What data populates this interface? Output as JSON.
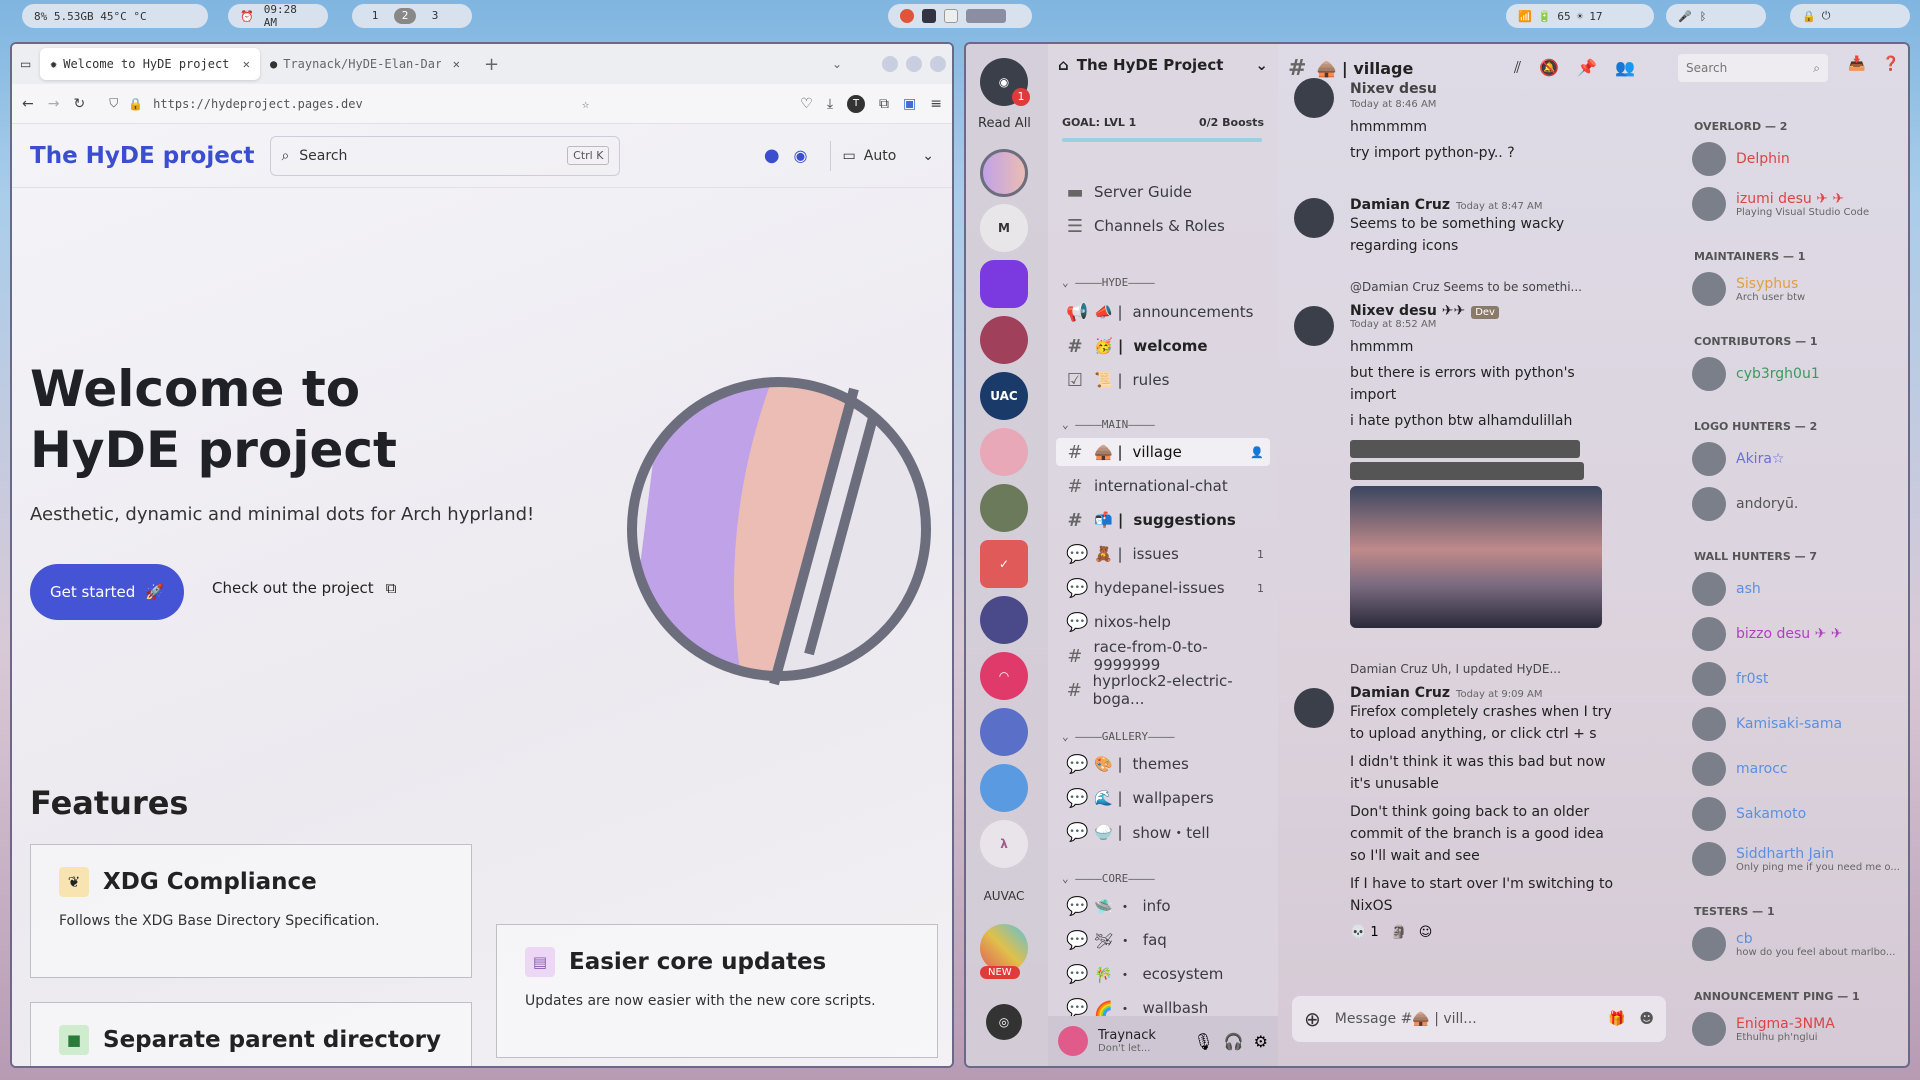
{
  "topbar": {
    "stats": "8%  5.53GB  45°C  °C",
    "time": "09:28 AM",
    "workspaces": [
      "1",
      "2",
      "3"
    ],
    "battery": "65",
    "brightness": "17"
  },
  "browser": {
    "tabs": [
      {
        "label": "Welcome to HyDE project |"
      },
      {
        "label": "Traynack/HyDE-Elan-Dark"
      }
    ],
    "url": "https://hydeproject.pages.dev",
    "site": {
      "brand": "The HyDE project",
      "search_placeholder": "Search",
      "search_kbd": "Ctrl K",
      "theme_label": "Auto",
      "hero_title": "Welcome to HyDE project",
      "hero_subtitle": "Aesthetic, dynamic and minimal dots for Arch hyprland!",
      "cta_primary": "Get started",
      "cta_secondary": "Check out the project",
      "features_heading": "Features",
      "features": [
        {
          "title": "XDG Compliance",
          "desc": "Follows the XDG Base Directory Specification.",
          "color": "#f0c040"
        },
        {
          "title": "Easier core updates",
          "desc": "Updates are now easier with the new core scripts.",
          "color": "#b08ad0"
        },
        {
          "title": "Separate parent directory",
          "desc": "",
          "color": "#3aa05a"
        }
      ]
    }
  },
  "discord": {
    "read_all": "Read All",
    "notif_count": "1",
    "guild_letter": "M",
    "auvac": "AUVAC",
    "new_badge": "NEW",
    "server_name": "The HyDE Project",
    "goal": "GOAL: LVL 1",
    "boosts": "0/2 Boosts",
    "nav": [
      "Server Guide",
      "Channels & Roles"
    ],
    "categories": [
      "HYDE",
      "MAIN",
      "GALLERY",
      "CORE"
    ],
    "channels": [
      {
        "name": "announcements",
        "prefix": "📣 |"
      },
      {
        "name": "welcome",
        "prefix": "🥳 |"
      },
      {
        "name": "rules",
        "prefix": "📜 |"
      },
      {
        "name": "village",
        "prefix": "🛖 |"
      },
      {
        "name": "international-chat",
        "prefix": ""
      },
      {
        "name": "suggestions",
        "prefix": "📬 |"
      },
      {
        "name": "issues",
        "prefix": "🧸 |",
        "badge": "1"
      },
      {
        "name": "hydepanel-issues",
        "prefix": "",
        "badge": "1"
      },
      {
        "name": "nixos-help",
        "prefix": ""
      },
      {
        "name": "race-from-0-to-9999999",
        "prefix": ""
      },
      {
        "name": "hyprlock2-electric-boga...",
        "prefix": ""
      },
      {
        "name": "themes",
        "prefix": "🎨 |"
      },
      {
        "name": "wallpapers",
        "prefix": "🌊 |"
      },
      {
        "name": "show・tell",
        "prefix": "🍚 |"
      },
      {
        "name": "info",
        "prefix": "🛸 ・"
      },
      {
        "name": "faq",
        "prefix": "🛩 ・"
      },
      {
        "name": "ecosystem",
        "prefix": "🎋 ・"
      },
      {
        "name": "wallbash",
        "prefix": "🌈 ・"
      }
    ],
    "user": {
      "name": "Traynack",
      "status": "Don't let..."
    },
    "chat_title": "🛖 | village",
    "search_placeholder": "Search",
    "messages": [
      {
        "name": "Nixev desu",
        "time": "Today at 8:46 AM",
        "lines": [
          "hmmmmm",
          "try import python-py.. ?"
        ]
      },
      {
        "name": "Damian Cruz",
        "time": "Today at 8:47 AM",
        "lines": [
          "Seems to be something wacky regarding icons"
        ]
      },
      {
        "reply": "@Damian Cruz Seems to be somethi...",
        "name": "Nixev desu ✈✈",
        "badge": "Dev",
        "time": "Today at 8:52 AM",
        "lines": [
          "hmmmm",
          "but there is errors with python's import",
          "i hate python btw alhamdulillah"
        ]
      },
      {
        "reply": "Damian Cruz Uh, I updated HyDE...",
        "name": "Damian Cruz",
        "time": "Today at 9:09 AM",
        "lines": [
          "Firefox completely crashes when I try to upload anything, or click ctrl + s",
          "I didn't think it was this bad but now it's unusable",
          "Don't think going back to an older commit of the branch is a good idea so I'll wait and see",
          "If I have to start over I'm switching to NixOS"
        ]
      }
    ],
    "reaction_count": "1",
    "composer_placeholder": "Message #🛖 | vill...",
    "member_groups": [
      {
        "header": "OVERLORD — 2",
        "members": [
          {
            "name": "Delphin",
            "color": "#d44"
          },
          {
            "name": "izumi desu ✈ ✈",
            "color": "#d44",
            "status": "Playing Visual Studio Code"
          }
        ]
      },
      {
        "header": "MAINTAINERS — 1",
        "members": [
          {
            "name": "Sisyphus",
            "color": "#e0a040",
            "status": "Arch user btw"
          }
        ]
      },
      {
        "header": "CONTRIBUTORS — 1",
        "members": [
          {
            "name": "cyb3rgh0u1",
            "color": "#3a9a5a"
          }
        ]
      },
      {
        "header": "LOGO HUNTERS — 2",
        "members": [
          {
            "name": "Akira☆",
            "color": "#6a70d6"
          },
          {
            "name": "andoryū.",
            "color": "#555"
          }
        ]
      },
      {
        "header": "WALL HUNTERS — 7",
        "members": [
          {
            "name": "ash",
            "color": "#5a90e0"
          },
          {
            "name": "bizzo desu ✈ ✈",
            "color": "#b040c0"
          },
          {
            "name": "fr0st",
            "color": "#5a90e0"
          },
          {
            "name": "Kamisaki-sama",
            "color": "#5a90e0"
          },
          {
            "name": "marocc",
            "color": "#5a90e0"
          },
          {
            "name": "Sakamoto",
            "color": "#5a90e0"
          },
          {
            "name": "Siddharth Jain",
            "color": "#5a90e0",
            "status": "Only ping me if you need me o..."
          }
        ]
      },
      {
        "header": "TESTERS — 1",
        "members": [
          {
            "name": "cb",
            "color": "#5a90e0",
            "status": "how do you feel about marlbo..."
          }
        ]
      },
      {
        "header": "ANNOUNCEMENT PING — 1",
        "members": [
          {
            "name": "Enigma-3NMA",
            "color": "#d44",
            "status": "Ethulhu ph'nglui"
          }
        ]
      }
    ]
  }
}
